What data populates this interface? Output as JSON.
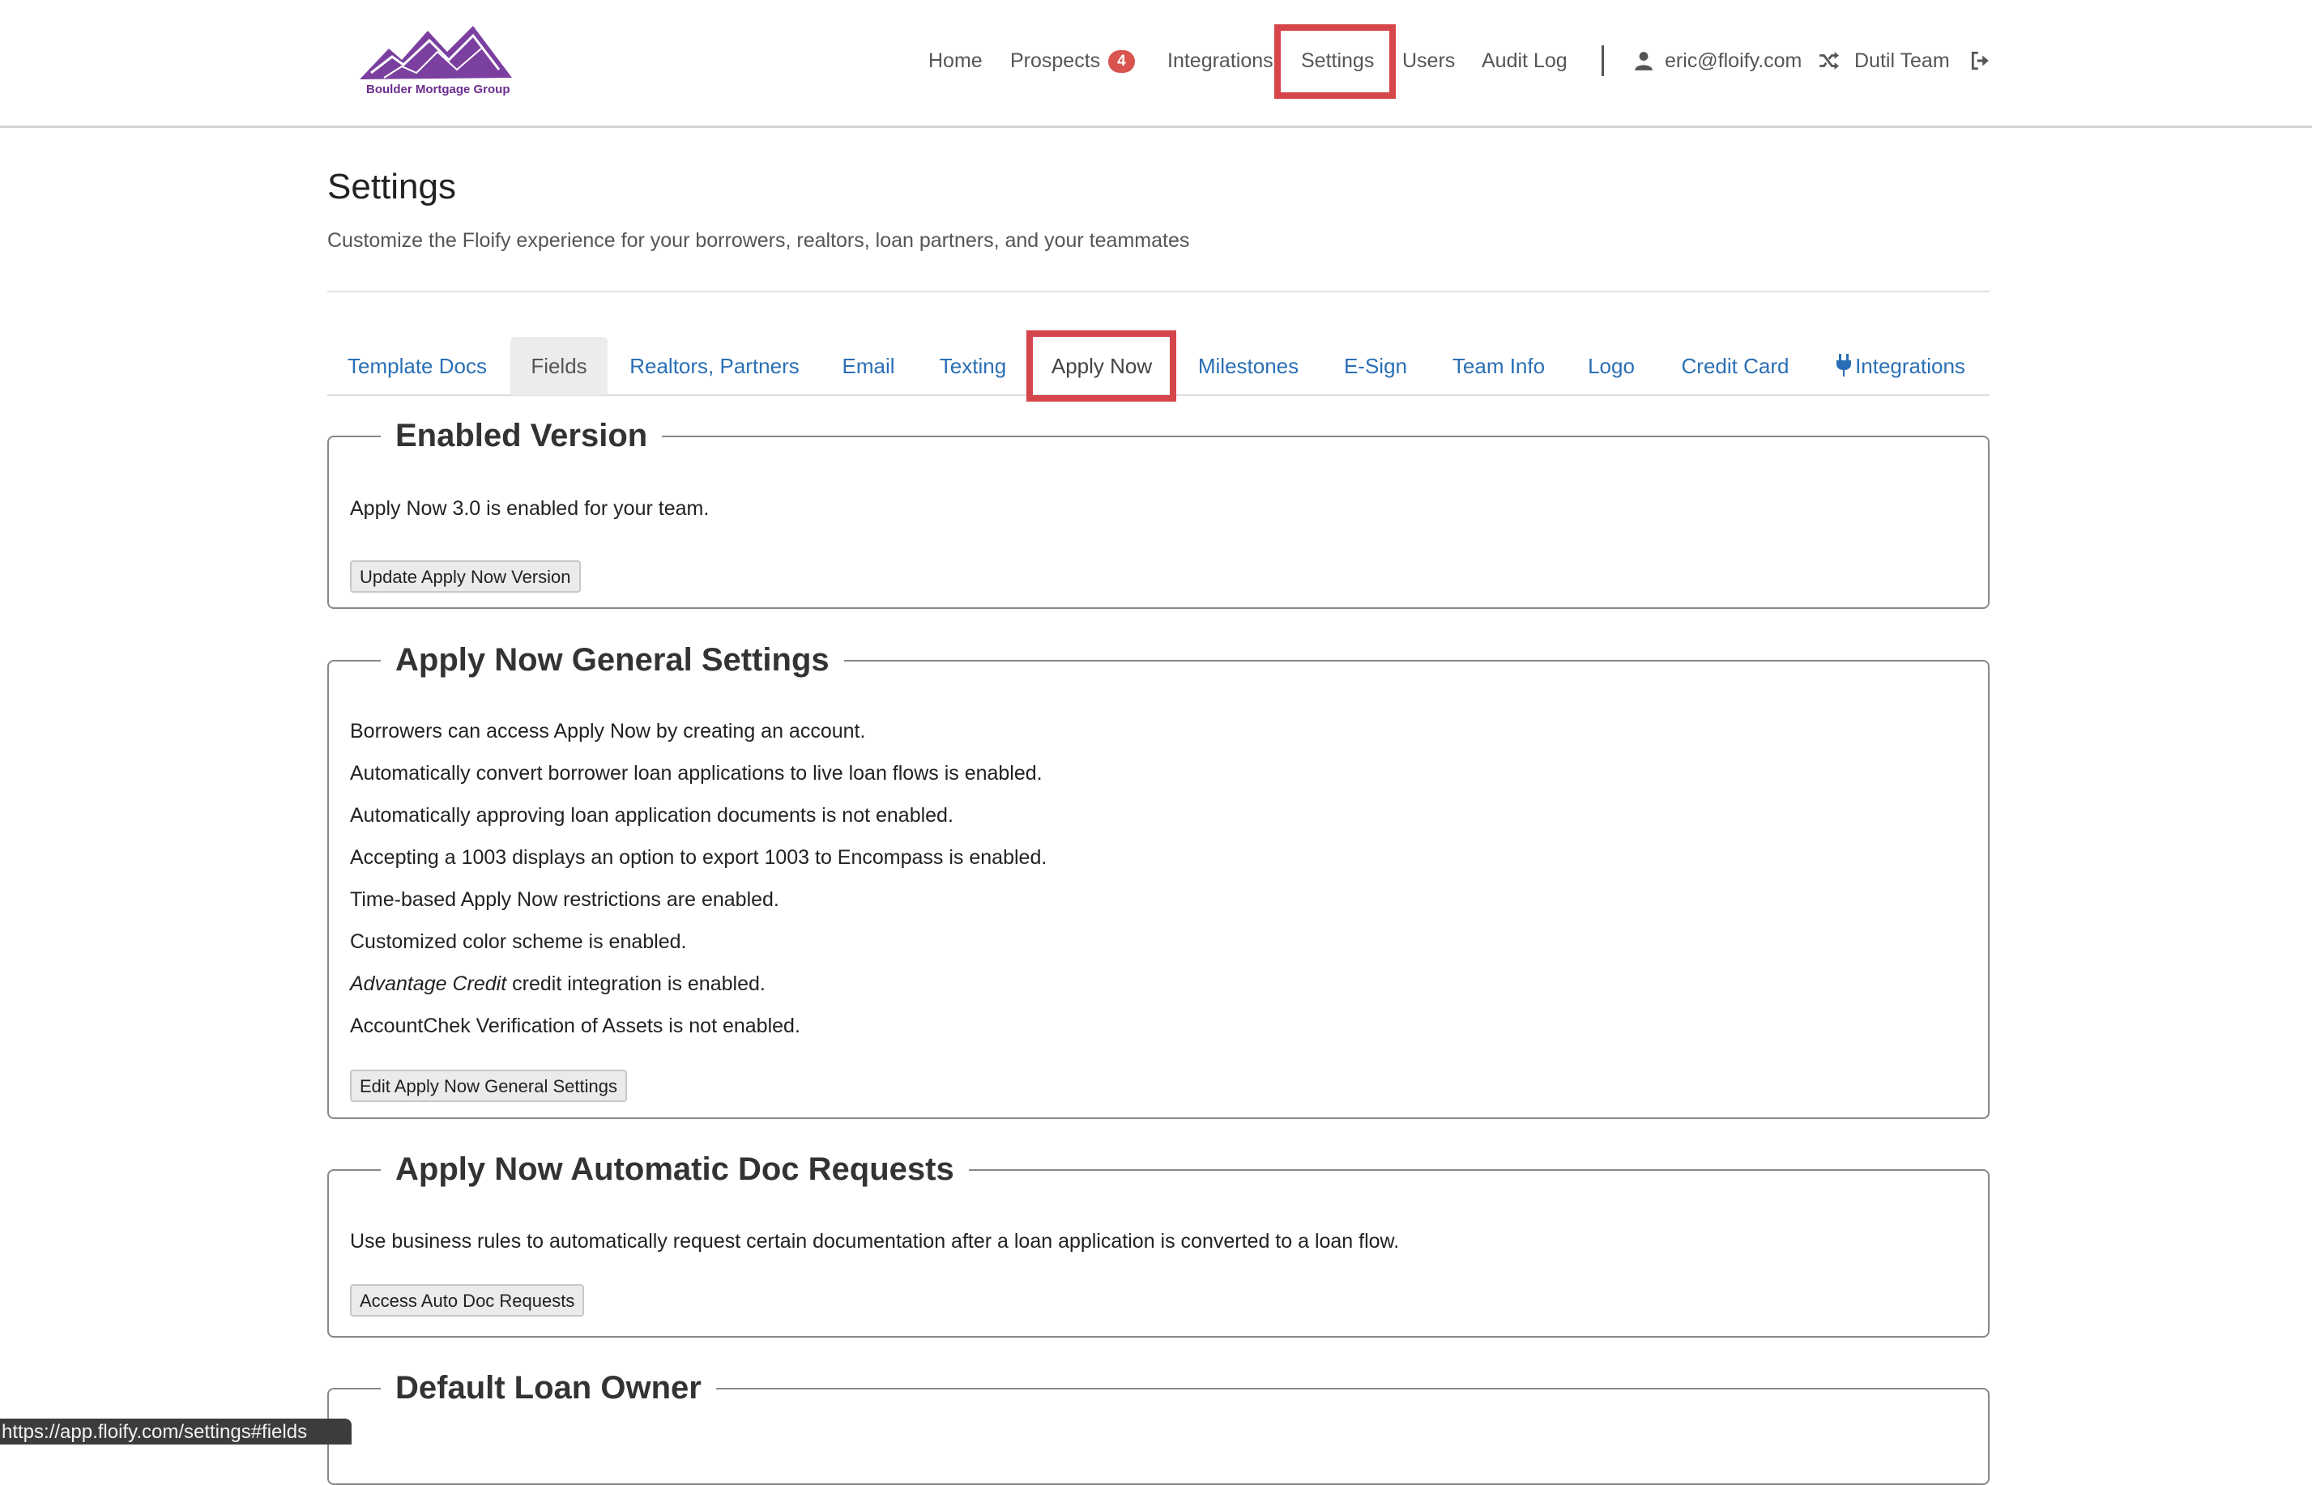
{
  "brand": {
    "logo_text": "Boulder Mortgage Group",
    "brand_color": "#7b3fa0"
  },
  "nav": {
    "home": "Home",
    "prospects": "Prospects",
    "prospects_count": "4",
    "integrations": "Integrations",
    "settings": "Settings",
    "users": "Users",
    "audit_log": "Audit Log",
    "user_email": "eric@floify.com",
    "team": "Dutil Team",
    "icons": [
      "user-icon",
      "shuffle-icon",
      "sign-out-icon"
    ]
  },
  "page": {
    "title": "Settings",
    "subtitle": "Customize the Floify experience for your borrowers, realtors, loan partners, and your teammates"
  },
  "tabs": [
    {
      "label": "Template Docs"
    },
    {
      "label": "Fields"
    },
    {
      "label": "Realtors, Partners"
    },
    {
      "label": "Email"
    },
    {
      "label": "Texting"
    },
    {
      "label": "Apply Now"
    },
    {
      "label": "Milestones"
    },
    {
      "label": "E-Sign"
    },
    {
      "label": "Team Info"
    },
    {
      "label": "Logo"
    },
    {
      "label": "Credit Card"
    },
    {
      "label": "Integrations"
    }
  ],
  "sections": {
    "enabled_version": {
      "title": "Enabled Version",
      "text": "Apply Now 3.0 is enabled for your team.",
      "button": "Update Apply Now Version"
    },
    "general_settings": {
      "title": "Apply Now General Settings",
      "lines": [
        "Borrowers can access Apply Now by creating an account.",
        "Automatically convert borrower loan applications to live loan flows is enabled.",
        "Automatically approving loan application documents is not enabled.",
        "Accepting a 1003 displays an option to export 1003 to Encompass is enabled.",
        "Time-based Apply Now restrictions are enabled.",
        "Customized color scheme is enabled."
      ],
      "credit_provider": "Advantage Credit",
      "credit_suffix": " credit integration is enabled.",
      "last_line": "AccountChek Verification of Assets is not enabled.",
      "button": "Edit Apply Now General Settings"
    },
    "auto_doc": {
      "title": "Apply Now Automatic Doc Requests",
      "text": "Use business rules to automatically request certain documentation after a loan application is converted to a loan flow.",
      "button": "Access Auto Doc Requests"
    },
    "default_owner": {
      "title": "Default Loan Owner"
    }
  },
  "status_bar": {
    "url": "https://app.floify.com/settings#fields"
  },
  "colors": {
    "link": "#2a6fb5",
    "highlight": "#d6454a",
    "badge": "#d9534f"
  }
}
